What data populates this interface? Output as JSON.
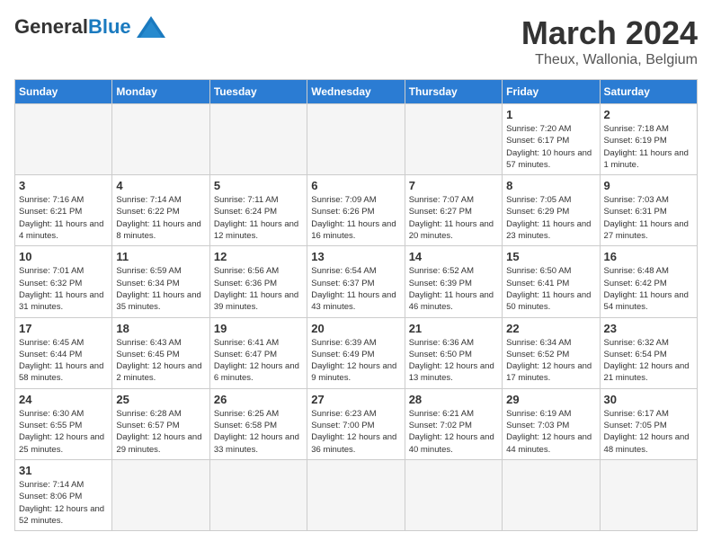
{
  "logo": {
    "general": "General",
    "blue": "Blue"
  },
  "title": {
    "month": "March 2024",
    "location": "Theux, Wallonia, Belgium"
  },
  "weekdays": [
    "Sunday",
    "Monday",
    "Tuesday",
    "Wednesday",
    "Thursday",
    "Friday",
    "Saturday"
  ],
  "weeks": [
    [
      {
        "day": "",
        "info": ""
      },
      {
        "day": "",
        "info": ""
      },
      {
        "day": "",
        "info": ""
      },
      {
        "day": "",
        "info": ""
      },
      {
        "day": "",
        "info": ""
      },
      {
        "day": "1",
        "info": "Sunrise: 7:20 AM\nSunset: 6:17 PM\nDaylight: 10 hours and 57 minutes."
      },
      {
        "day": "2",
        "info": "Sunrise: 7:18 AM\nSunset: 6:19 PM\nDaylight: 11 hours and 1 minute."
      }
    ],
    [
      {
        "day": "3",
        "info": "Sunrise: 7:16 AM\nSunset: 6:21 PM\nDaylight: 11 hours and 4 minutes."
      },
      {
        "day": "4",
        "info": "Sunrise: 7:14 AM\nSunset: 6:22 PM\nDaylight: 11 hours and 8 minutes."
      },
      {
        "day": "5",
        "info": "Sunrise: 7:11 AM\nSunset: 6:24 PM\nDaylight: 11 hours and 12 minutes."
      },
      {
        "day": "6",
        "info": "Sunrise: 7:09 AM\nSunset: 6:26 PM\nDaylight: 11 hours and 16 minutes."
      },
      {
        "day": "7",
        "info": "Sunrise: 7:07 AM\nSunset: 6:27 PM\nDaylight: 11 hours and 20 minutes."
      },
      {
        "day": "8",
        "info": "Sunrise: 7:05 AM\nSunset: 6:29 PM\nDaylight: 11 hours and 23 minutes."
      },
      {
        "day": "9",
        "info": "Sunrise: 7:03 AM\nSunset: 6:31 PM\nDaylight: 11 hours and 27 minutes."
      }
    ],
    [
      {
        "day": "10",
        "info": "Sunrise: 7:01 AM\nSunset: 6:32 PM\nDaylight: 11 hours and 31 minutes."
      },
      {
        "day": "11",
        "info": "Sunrise: 6:59 AM\nSunset: 6:34 PM\nDaylight: 11 hours and 35 minutes."
      },
      {
        "day": "12",
        "info": "Sunrise: 6:56 AM\nSunset: 6:36 PM\nDaylight: 11 hours and 39 minutes."
      },
      {
        "day": "13",
        "info": "Sunrise: 6:54 AM\nSunset: 6:37 PM\nDaylight: 11 hours and 43 minutes."
      },
      {
        "day": "14",
        "info": "Sunrise: 6:52 AM\nSunset: 6:39 PM\nDaylight: 11 hours and 46 minutes."
      },
      {
        "day": "15",
        "info": "Sunrise: 6:50 AM\nSunset: 6:41 PM\nDaylight: 11 hours and 50 minutes."
      },
      {
        "day": "16",
        "info": "Sunrise: 6:48 AM\nSunset: 6:42 PM\nDaylight: 11 hours and 54 minutes."
      }
    ],
    [
      {
        "day": "17",
        "info": "Sunrise: 6:45 AM\nSunset: 6:44 PM\nDaylight: 11 hours and 58 minutes."
      },
      {
        "day": "18",
        "info": "Sunrise: 6:43 AM\nSunset: 6:45 PM\nDaylight: 12 hours and 2 minutes."
      },
      {
        "day": "19",
        "info": "Sunrise: 6:41 AM\nSunset: 6:47 PM\nDaylight: 12 hours and 6 minutes."
      },
      {
        "day": "20",
        "info": "Sunrise: 6:39 AM\nSunset: 6:49 PM\nDaylight: 12 hours and 9 minutes."
      },
      {
        "day": "21",
        "info": "Sunrise: 6:36 AM\nSunset: 6:50 PM\nDaylight: 12 hours and 13 minutes."
      },
      {
        "day": "22",
        "info": "Sunrise: 6:34 AM\nSunset: 6:52 PM\nDaylight: 12 hours and 17 minutes."
      },
      {
        "day": "23",
        "info": "Sunrise: 6:32 AM\nSunset: 6:54 PM\nDaylight: 12 hours and 21 minutes."
      }
    ],
    [
      {
        "day": "24",
        "info": "Sunrise: 6:30 AM\nSunset: 6:55 PM\nDaylight: 12 hours and 25 minutes."
      },
      {
        "day": "25",
        "info": "Sunrise: 6:28 AM\nSunset: 6:57 PM\nDaylight: 12 hours and 29 minutes."
      },
      {
        "day": "26",
        "info": "Sunrise: 6:25 AM\nSunset: 6:58 PM\nDaylight: 12 hours and 33 minutes."
      },
      {
        "day": "27",
        "info": "Sunrise: 6:23 AM\nSunset: 7:00 PM\nDaylight: 12 hours and 36 minutes."
      },
      {
        "day": "28",
        "info": "Sunrise: 6:21 AM\nSunset: 7:02 PM\nDaylight: 12 hours and 40 minutes."
      },
      {
        "day": "29",
        "info": "Sunrise: 6:19 AM\nSunset: 7:03 PM\nDaylight: 12 hours and 44 minutes."
      },
      {
        "day": "30",
        "info": "Sunrise: 6:17 AM\nSunset: 7:05 PM\nDaylight: 12 hours and 48 minutes."
      }
    ],
    [
      {
        "day": "31",
        "info": "Sunrise: 7:14 AM\nSunset: 8:06 PM\nDaylight: 12 hours and 52 minutes."
      },
      {
        "day": "",
        "info": ""
      },
      {
        "day": "",
        "info": ""
      },
      {
        "day": "",
        "info": ""
      },
      {
        "day": "",
        "info": ""
      },
      {
        "day": "",
        "info": ""
      },
      {
        "day": "",
        "info": ""
      }
    ]
  ]
}
